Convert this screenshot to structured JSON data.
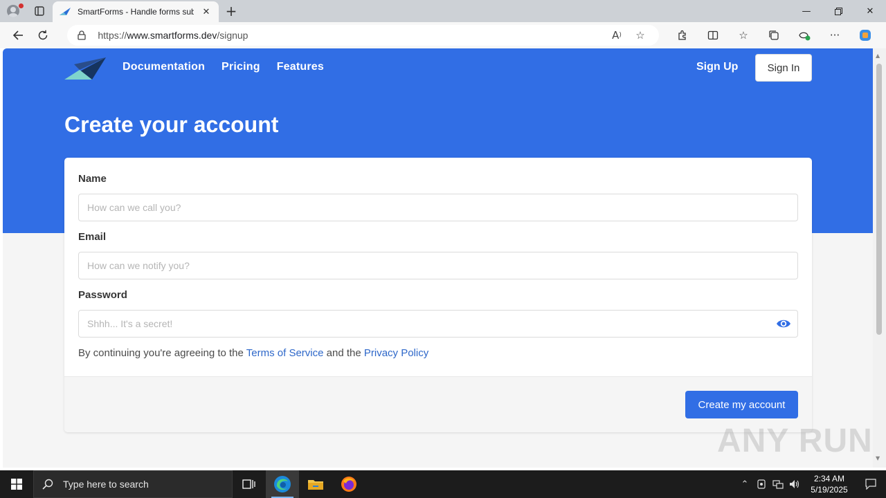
{
  "browser": {
    "tab_title": "SmartForms - Handle forms submissions",
    "url_prefix": "https://",
    "url_host": "www.smartforms.dev",
    "url_path": "/signup"
  },
  "site": {
    "nav": {
      "documentation": "Documentation",
      "pricing": "Pricing",
      "features": "Features",
      "sign_up": "Sign Up",
      "sign_in": "Sign In"
    },
    "title": "Create your account",
    "form": {
      "name_label": "Name",
      "name_placeholder": "How can we call you?",
      "email_label": "Email",
      "email_placeholder": "How can we notify you?",
      "password_label": "Password",
      "password_placeholder": "Shhh... It's a secret!",
      "terms_prefix": "By continuing you're agreeing to the ",
      "terms_link": "Terms of Service",
      "terms_middle": " and the ",
      "privacy_link": "Privacy Policy",
      "submit": "Create my account"
    },
    "brand_color": "#316ee5"
  },
  "watermark": "ANY RUN",
  "taskbar": {
    "search_placeholder": "Type here to search",
    "time": "2:34 AM",
    "date": "5/19/2025"
  }
}
